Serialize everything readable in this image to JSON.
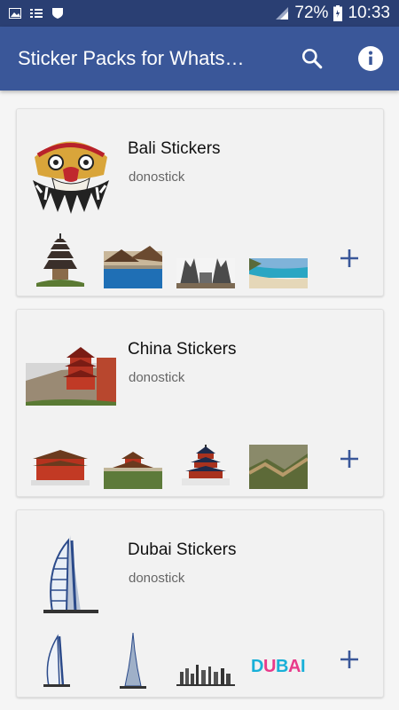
{
  "status_bar": {
    "battery": "72%",
    "time": "10:33",
    "icons": [
      "image-icon",
      "list-icon",
      "shield-icon",
      "signal-icon",
      "battery-icon"
    ]
  },
  "app_bar": {
    "title": "Sticker Packs for Whats…",
    "actions": [
      "search-icon",
      "info-icon"
    ]
  },
  "colors": {
    "status_bar": "#2a3f73",
    "app_bar": "#3a5799",
    "accent": "#3a5799",
    "card_bg": "#f2f2f2"
  },
  "packs": [
    {
      "name": "Bali Stickers",
      "publisher": "donostick",
      "main_image": "barong-mask",
      "thumbnails": [
        "pagoda-temple",
        "pool-resort",
        "temple-gate",
        "beach"
      ]
    },
    {
      "name": "China Stickers",
      "publisher": "donostick",
      "main_image": "red-pagoda-cliff",
      "thumbnails": [
        "palace-hall",
        "garden-pavilion",
        "temple-of-heaven",
        "great-wall"
      ]
    },
    {
      "name": "Dubai Stickers",
      "publisher": "donostick",
      "main_image": "burj-al-arab",
      "thumbnails": [
        "burj-al-arab-small",
        "burj-khalifa",
        "skyline",
        "dubai-logo"
      ]
    }
  ]
}
